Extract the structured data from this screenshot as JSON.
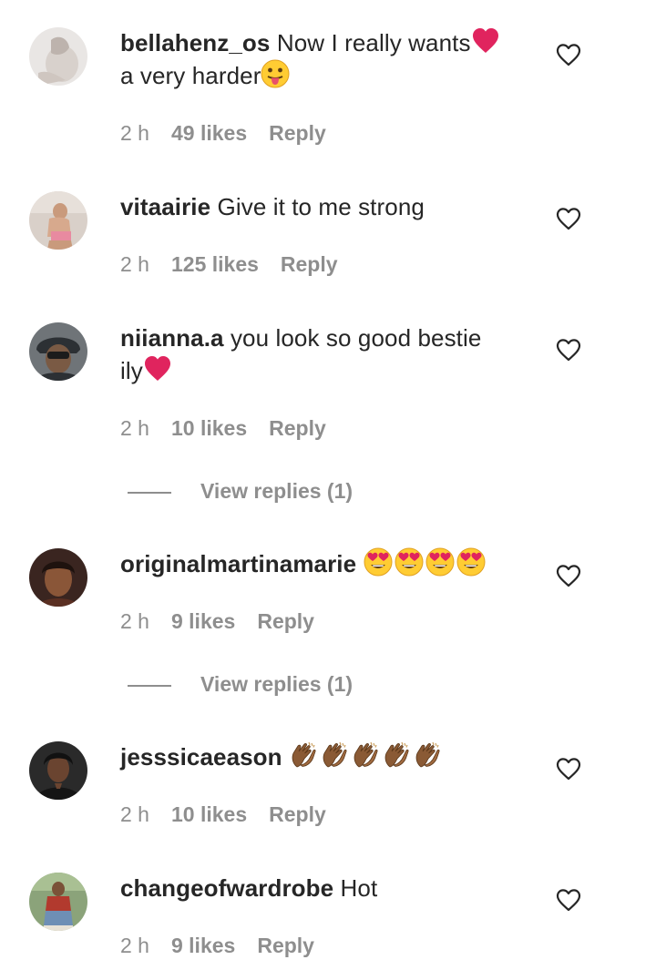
{
  "comments": [
    {
      "username": "bellahenz_os",
      "text_a": "Now I really wants",
      "text_b": "a very harder",
      "time": "2 h",
      "likes": "49 likes",
      "reply": "Reply",
      "emojis": [
        "red-heart-emoji",
        "tongue-face-emoji"
      ]
    },
    {
      "username": "vitaairie",
      "text_a": "Give it to me strong",
      "time": "2 h",
      "likes": "125 likes",
      "reply": "Reply"
    },
    {
      "username": "niianna.a",
      "text_a": "you look so good bestie",
      "text_b": "ily",
      "time": "2 h",
      "likes": "10 likes",
      "reply": "Reply",
      "emojis": [
        "red-heart-emoji"
      ],
      "view_replies": "View replies (1)"
    },
    {
      "username": "originalmartinamarie",
      "text_a": "",
      "time": "2 h",
      "likes": "9 likes",
      "reply": "Reply",
      "emojis": [
        "heart-eyes-emoji",
        "heart-eyes-emoji",
        "heart-eyes-emoji",
        "heart-eyes-emoji"
      ],
      "view_replies": "View replies (1)"
    },
    {
      "username": "jesssicaeason",
      "text_a": "",
      "time": "2 h",
      "likes": "10 likes",
      "reply": "Reply",
      "emojis": [
        "clapping-hands-emoji",
        "clapping-hands-emoji",
        "clapping-hands-emoji",
        "clapping-hands-emoji",
        "clapping-hands-emoji"
      ]
    },
    {
      "username": "changeofwardrobe",
      "text_a": "Hot",
      "time": "2 h",
      "likes": "9 likes",
      "reply": "Reply"
    }
  ],
  "colors": {
    "text": "#262626",
    "secondary": "#8e8e8e",
    "heart_red": "#e0245e"
  },
  "icons": {
    "like": "heart-outline-icon"
  }
}
